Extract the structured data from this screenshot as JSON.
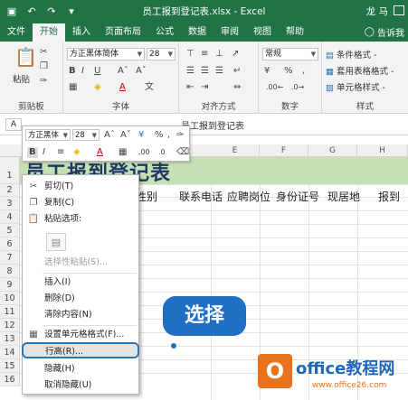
{
  "titlebar": {
    "save_icon": "save-icon",
    "undo_icon": "undo-icon",
    "redo_icon": "redo-icon",
    "customize_icon": "customize-icon",
    "title": "员工报到登记表.xlsx - Excel",
    "user": "龙 马"
  },
  "tabs": [
    "文件",
    "开始",
    "插入",
    "页面布局",
    "公式",
    "数据",
    "审阅",
    "视图",
    "帮助"
  ],
  "active_tab": "开始",
  "tell_me": "告诉我",
  "ribbon": {
    "clipboard": {
      "paste": "粘贴",
      "label": "剪贴板"
    },
    "font": {
      "name": "方正黑体简体",
      "size": "28",
      "label": "字体"
    },
    "alignment": {
      "label": "对齐方式"
    },
    "number": {
      "format": "常规",
      "percent": "%",
      "comma": ",",
      "label": "数字"
    },
    "styles": {
      "conditional": "条件格式 -",
      "table": "套用表格格式 -",
      "cell": "单元格样式 -",
      "label": "样式"
    }
  },
  "formula_bar": {
    "name_box": "A",
    "content": "员工报到登记表"
  },
  "mini_toolbar": {
    "font": "方正黑体",
    "size": "28",
    "percent": "%",
    "comma": ","
  },
  "columns": [
    "E",
    "F",
    "G",
    "H"
  ],
  "rows": [
    "1",
    "2",
    "3",
    "4",
    "5",
    "6",
    "7",
    "8",
    "9",
    "10",
    "11",
    "12",
    "13",
    "14",
    "15",
    "16"
  ],
  "sheet": {
    "title": "员工报到登记表",
    "headers": [
      "性别",
      "联系电话",
      "应聘岗位",
      "身份证号",
      "现居地",
      "报到"
    ]
  },
  "context_menu": {
    "cut": "剪切(T)",
    "copy": "复制(C)",
    "paste_options": "粘贴选项:",
    "paste_special": "选择性粘贴(S)...",
    "insert": "插入(I)",
    "delete": "删除(D)",
    "clear": "清除内容(N)",
    "format_cells": "设置单元格格式(F)...",
    "row_height": "行高(R)...",
    "hide": "隐藏(H)",
    "unhide": "取消隐藏(U)"
  },
  "callout": "选择",
  "watermark": {
    "logo": "O",
    "text": "office教程网",
    "url": "www.office26.com"
  },
  "colors": {
    "excel_green": "#217346",
    "title_fill": "#c6dfb5",
    "callout_blue": "#1f6fc5"
  }
}
